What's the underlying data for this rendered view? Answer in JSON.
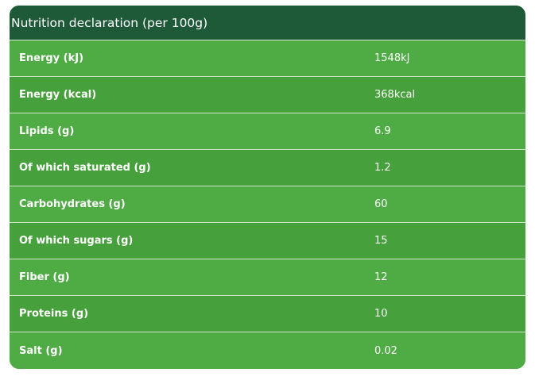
{
  "table": {
    "title": "Nutrition declaration (per 100g)",
    "rows": [
      {
        "label": "Energy (kJ)",
        "value": "1548kJ"
      },
      {
        "label": "Energy (kcal)",
        "value": "368kcal"
      },
      {
        "label": "Lipids (g)",
        "value": "6.9"
      },
      {
        "label": "Of which saturated (g)",
        "value": "1.2"
      },
      {
        "label": "Carbohydrates (g)",
        "value": "60"
      },
      {
        "label": "Of which sugars (g)",
        "value": "15"
      },
      {
        "label": "Fiber (g)",
        "value": "12"
      },
      {
        "label": "Proteins (g)",
        "value": "10"
      },
      {
        "label": "Salt (g)",
        "value": "0.02"
      }
    ]
  },
  "colors": {
    "header_bg": "#1e5a38",
    "row_bg": "#4aa63f",
    "text": "#ffffff"
  }
}
